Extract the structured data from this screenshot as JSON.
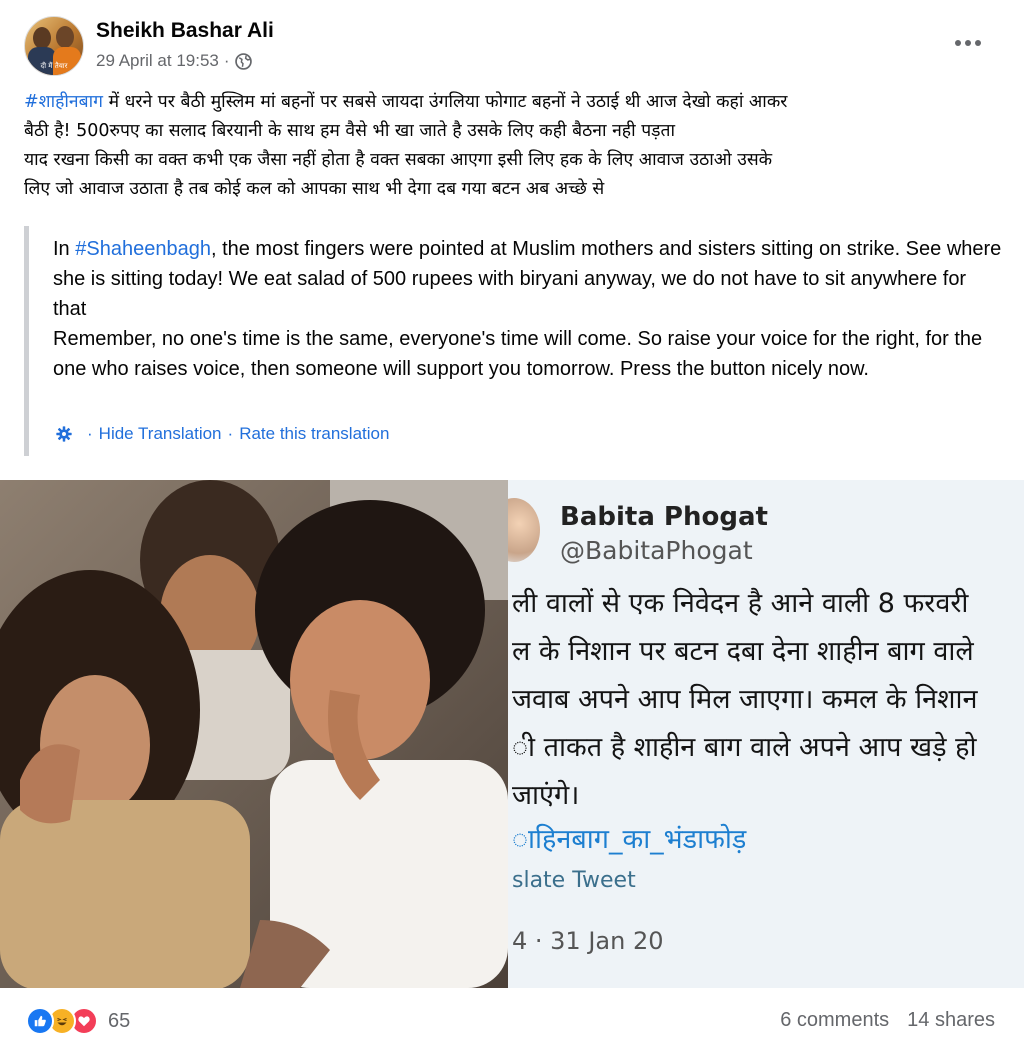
{
  "post": {
    "author": "Sheikh Bashar Ali",
    "timestamp": "29 April at 19:53",
    "separator": "·",
    "avatar_caption": "दी मैं तैयार"
  },
  "body": {
    "hashtag": "#शाहीनबाग",
    "line1_rest": " में धरने पर बैठी मुस्लिम मां बहनों  पर सबसे जायदा उंगलिया फोगाट बहनों ने उठाई थी आज देखो कहां आकर",
    "line2": "बैठी है! 500रुपए का सलाद बिरयानी के साथ हम वैसे भी खा जाते है उसके लिए कही बैठना नही पड़ता",
    "line3": "याद रखना किसी का वक्त कभी एक जैसा नहीं होता है वक्त सबका आएगा इसी लिए हक के लिए आवाज उठाओ उसके",
    "line4": "लिए जो आवाज उठाता है तब कोई  कल को आपका साथ भी देगा  दब गया बटन अब अच्छे से"
  },
  "translation": {
    "prefix": "In ",
    "hashtag": "#Shaheenbagh",
    "para1_rest": ", the most fingers were pointed at Muslim mothers and sisters sitting on strike. See where she is sitting today! We eat salad of 500 rupees with biryani anyway, we do not have to sit anywhere for that",
    "para2": "Remember, no one's time is the same, everyone's time will come. So raise your voice for the right, for the one who raises voice, then someone will support you tomorrow. Press the button nicely now.",
    "hide_label": "Hide Translation",
    "rate_label": "Rate this translation",
    "sep": "·"
  },
  "tweet": {
    "name": "Babita Phogat",
    "handle": "@BabitaPhogat",
    "lines": [
      "ली वालों से एक निवेदन है आने वाली 8 फरवरी",
      "ल के निशान पर बटन दबा देना  शाहीन बाग वाले",
      "जवाब अपने आप मिल जाएगा। कमल के निशान",
      "ी ताकत है शाहीन बाग वाले अपने आप खड़े हो",
      "जाएंगे।"
    ],
    "tag": "ाहिनबाग_का_भंडाफोड़",
    "translate": "slate Tweet",
    "date": "4 · 31 Jan 20"
  },
  "footer": {
    "reaction_count": "65",
    "comments": "6 comments",
    "shares": "14 shares"
  },
  "icons": {
    "like": "like-icon",
    "haha": "haha-icon",
    "love": "love-icon",
    "globe": "globe-icon",
    "gear": "gear-icon",
    "more": "more-options-icon"
  },
  "colors": {
    "link": "#216fdb",
    "secondary_text": "#65676b",
    "like_blue": "#1877f2",
    "haha_yellow": "#f7b125",
    "love_red": "#f33e58"
  }
}
